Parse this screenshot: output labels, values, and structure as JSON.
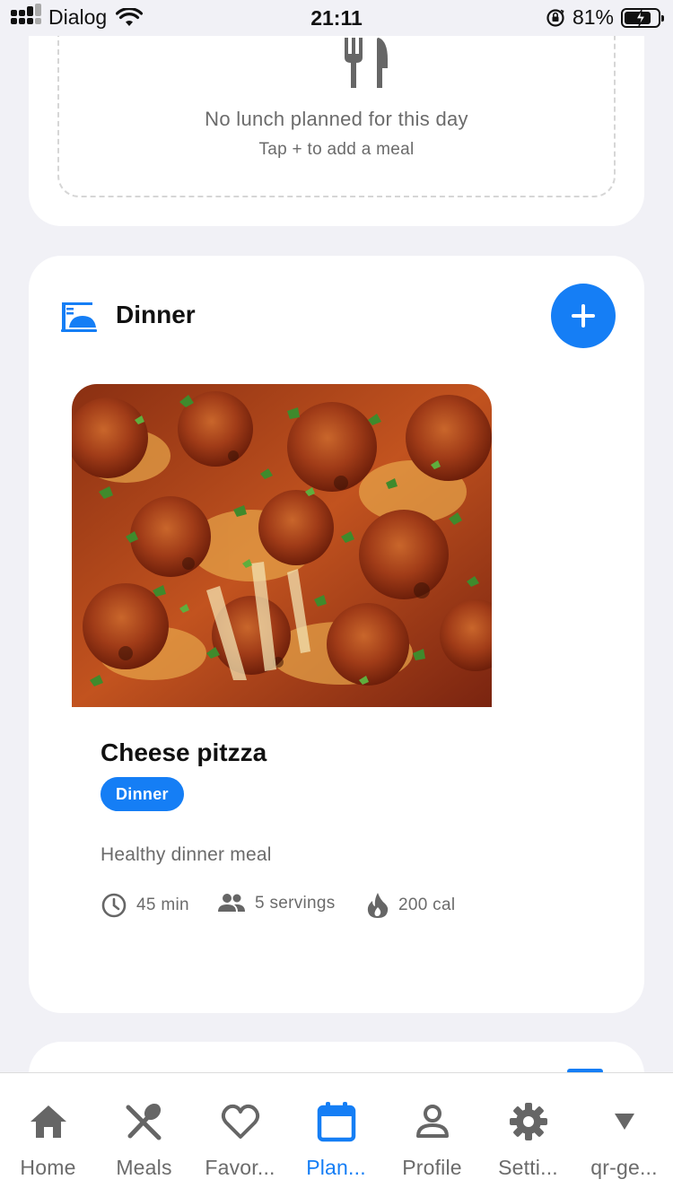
{
  "status_bar": {
    "carrier": "Dialog",
    "time": "21:11",
    "battery": "81%",
    "battery_level": 0.81
  },
  "lunch": {
    "empty_title": "No lunch planned for this day",
    "empty_subtitle": "Tap + to add a meal",
    "icon": "fork-knife-icon"
  },
  "dinner": {
    "title": "Dinner",
    "icon": "dinner-plate-icon",
    "add_icon": "plus-icon",
    "meal": {
      "name": "Cheese pitzza",
      "tag": "Dinner",
      "description": "Healthy dinner meal",
      "time": "45 min",
      "servings": "5 servings",
      "calories": "200 cal"
    }
  },
  "tabs": [
    {
      "label": "Home",
      "icon": "home-icon",
      "active": false
    },
    {
      "label": "Meals",
      "icon": "utensils-icon",
      "active": false
    },
    {
      "label": "Favor...",
      "icon": "heart-icon",
      "active": false
    },
    {
      "label": "Plan...",
      "icon": "calendar-icon",
      "active": true
    },
    {
      "label": "Profile",
      "icon": "person-icon",
      "active": false
    },
    {
      "label": "Setti...",
      "icon": "gear-icon",
      "active": false
    },
    {
      "label": "qr-ge...",
      "icon": "triangle-down-icon",
      "active": false
    }
  ],
  "colors": {
    "accent": "#157ef5",
    "background": "#f1f1f6",
    "text_secondary": "#6b6b6b"
  }
}
